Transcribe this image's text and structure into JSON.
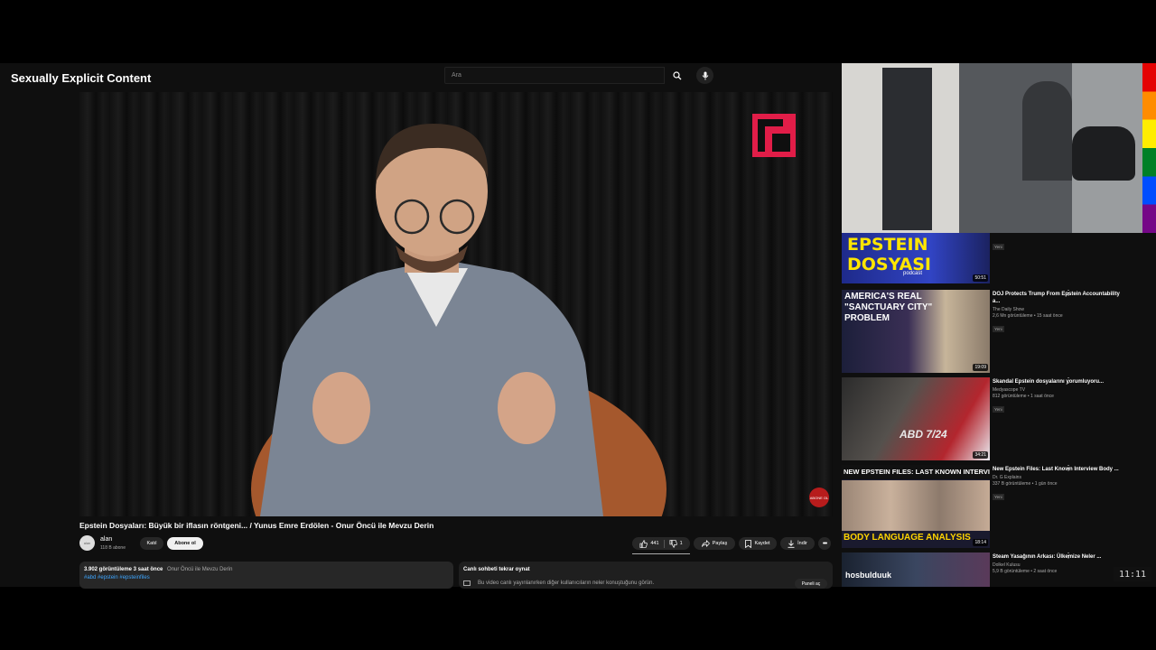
{
  "overlay_title": "Sexually Explicit Content",
  "search": {
    "placeholder": "Ara"
  },
  "player": {
    "live_badge": "ABONE OL"
  },
  "video": {
    "title": "Epstein Dosyaları: Büyük bir iflasın röntgeni... / Yunus Emre Erdölen - Onur Öncü ile Mevzu Derin",
    "channel_name": "alan",
    "channel_subs": "118 B abone",
    "avatar_text": "alan",
    "join_label": "Katıl",
    "subscribe_label": "Abone ol",
    "likes": "441",
    "dislikes": "1",
    "share_label": "Paylaş",
    "save_label": "Kaydet",
    "download_label": "İndir"
  },
  "description": {
    "stats": "3.902 görüntüleme  3 saat önce",
    "show": "Onur Öncü ile Mevzu Derin",
    "hashtags": "#abd #epstein #epsteinfiles"
  },
  "chat": {
    "title": "Canlı sohbeti tekrar oynat",
    "text": "Bu video canlı yayınlanırken diğer kullanıcıların neler konuştuğunu görün.",
    "open_label": "Paneli aç"
  },
  "recommendations": [
    {
      "thumb_text": "EPSTEIN DOSYASI",
      "thumb_sub": "podcast",
      "duration": "50:51",
      "badge": "Yeni"
    },
    {
      "thumb_text": "AMERICA'S REAL \"SANCTUARY CITY\" PROBLEM",
      "duration": "19:09",
      "title": "DOJ Protects Trump From Epstein Accountability a...",
      "channel": "The Daily Show",
      "meta": "2,6 Mn görüntüleme • 15 saat önce",
      "badge": "Yeni"
    },
    {
      "thumb_text": "ABD 7/24",
      "duration": "34:21",
      "title": "Skandal Epstein dosyalarını yorumluyoru...",
      "channel": "Medyascope TV",
      "meta": "812 görüntüleme • 1 saat önce",
      "badge": "Yeni"
    },
    {
      "thumb_text": "NEW EPSTEIN FILES: LAST KNOWN INTERVIEW",
      "thumb_sub": "BODY LANGUAGE ANALYSIS",
      "duration": "18:14",
      "title": "New Epstein Files: Last Known Interview Body ...",
      "channel": "Dr. G Explains",
      "meta": "337 B görüntüleme • 1 gün önce",
      "badge": "Yeni"
    },
    {
      "thumb_text": "hosbulduuk",
      "duration": "",
      "title": "Steam Yasağının Arkası: Ülkemize Neler ...",
      "channel": "Dolkel Kulusu",
      "meta": "5,9 B görüntüleme • 2 saat önce"
    }
  ],
  "clock": "11:11",
  "colors": {
    "background": "#0f0f0f",
    "accent_red": "#e11d48",
    "subscribe_bg": "#f1f1f1"
  }
}
